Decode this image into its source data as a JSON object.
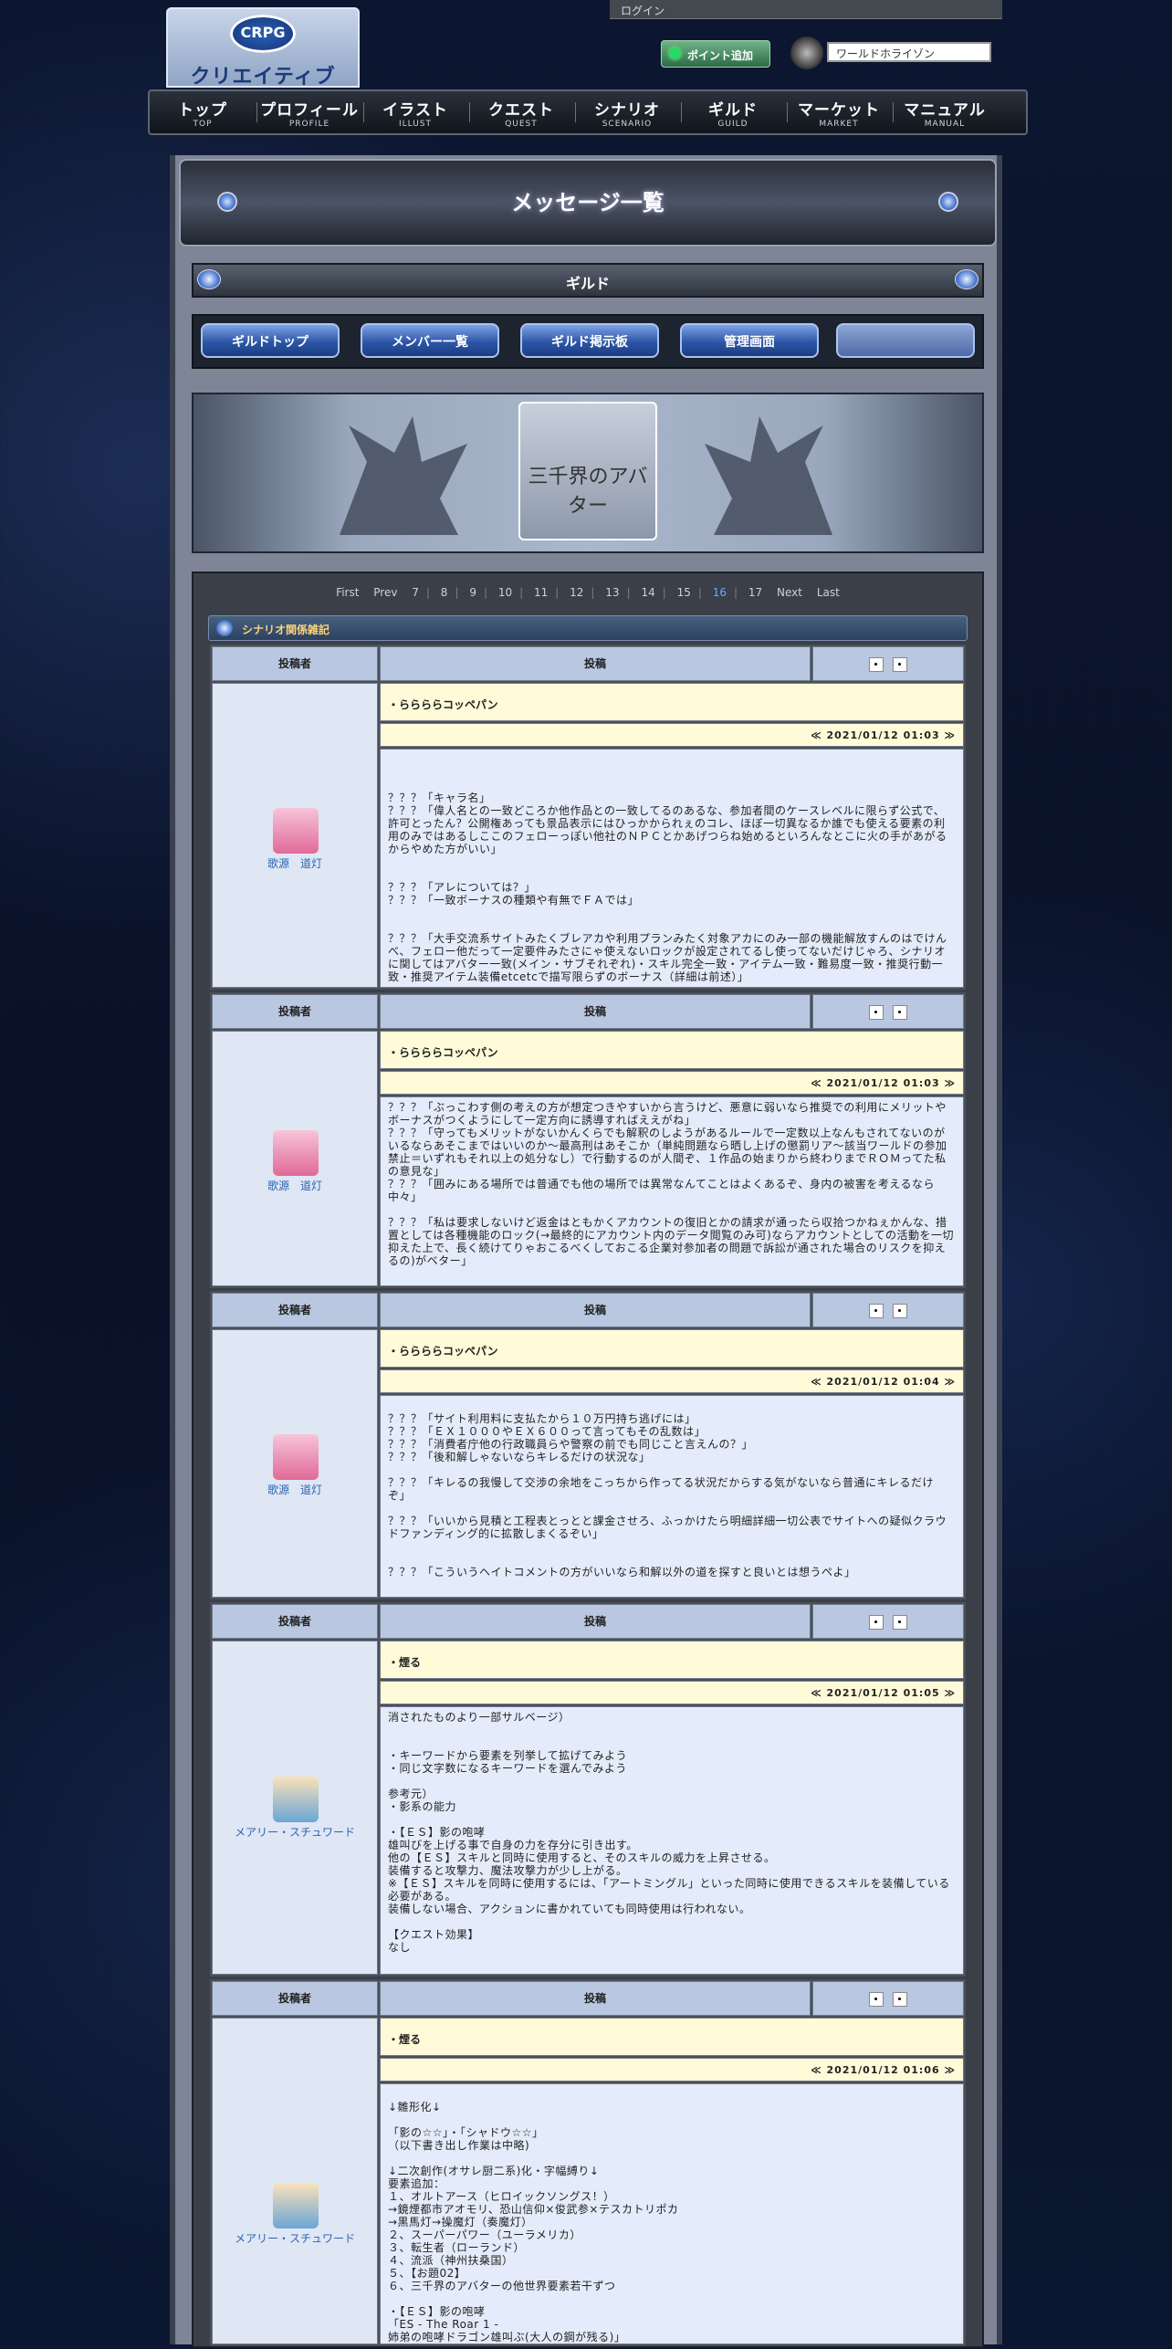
{
  "header": {
    "logo_top": "CRPG",
    "logo_name": "クリエイティブRPG",
    "login": "ログイン",
    "point_button": "ポイント追加",
    "world_value": "ワールドホライゾン"
  },
  "nav": [
    {
      "jp": "トップ",
      "en": "TOP"
    },
    {
      "jp": "プロフィール",
      "en": "PROFILE"
    },
    {
      "jp": "イラスト",
      "en": "ILLUST"
    },
    {
      "jp": "クエスト",
      "en": "QUEST"
    },
    {
      "jp": "シナリオ",
      "en": "SCENARIO"
    },
    {
      "jp": "ギルド",
      "en": "GUILD"
    },
    {
      "jp": "マーケット",
      "en": "MARKET"
    },
    {
      "jp": "マニュアル",
      "en": "MANUAL"
    }
  ],
  "page_title": "メッセージ一覧",
  "guild_bar": "ギルド",
  "guild_tabs": [
    "ギルドトップ",
    "メンバー一覧",
    "ギルド掲示板",
    "管理画面",
    ""
  ],
  "banner_text": "三千界のアバター",
  "pager": {
    "first": "First",
    "prev": "Prev",
    "pages": [
      "7",
      "8",
      "9",
      "10",
      "11",
      "12",
      "13",
      "14",
      "15",
      "16",
      "17"
    ],
    "current": "16",
    "next": "Next",
    "last": "Last"
  },
  "section_title": "シナリオ関係雑記",
  "table_headers": {
    "author": "投稿者",
    "post": "投稿"
  },
  "posts": [
    {
      "author": "歌源　道灯",
      "subject": "・ららららコッペパン",
      "date": "≪ 2021/01/12 01:03 ≫",
      "body": "\n\n\n？？？「キャラ名」\n？？？「偉人名との一致どころか他作品との一致してるのあるな、参加者間のケースレベルに限らず公式で、許可とったん？公開権あっても景品表示にはひっかかられぇのコレ、ほぼ一切異なるか誰でも使える要素の利用のみではあるしここのフェローっぽい他社のＮＰＣとかあげつらね始めるといろんなとこに火の手があがるからやめた方がいい」\n\n\n？？？「アレについては？」\n？？？「一致ボーナスの種類や有無でＦＡでは」\n\n\n？？？「大手交流系サイトみたくブレアカや利用プランみたく対象アカにのみ一部の機能解放すんのはでけんべ、フェロー他だって一定要件みたさにゃ使えないロックが設定されてるし使ってないだけじゃろ、シナリオに関してはアバター一致(メイン・サブそれぞれ)・スキル完全一致・アイテム一致・難易度一致・推奨行動一致・推奨アイテム装備etcetcで描写限らずのボーナス（詳細は前述）」"
    },
    {
      "author": "歌源　道灯",
      "subject": "・ららららコッペパン",
      "date": "≪ 2021/01/12 01:03 ≫",
      "body": "？？？「ぶっこわす側の考えの方が想定つきやすいから言うけど、悪意に弱いなら推奨での利用にメリットやボーナスがつくようにして一定方向に誘導すればええがね」\n？？？「守ってもメリットがないかんくらでも解釈のしようがあるルールで一定数以上なんもされてないのがいるならあそこまではいいのか〜最高刑はあそこか（単純問題なら晒し上げの懲罰リア〜該当ワールドの参加禁止＝いずれもそれ以上の処分なし）で行動するのが人間ぞ、１作品の始まりから終わりまでＲＯＭってた私の意見な」\n？？？「囲みにある場所では普通でも他の場所では異常なんてことはよくあるぞ、身内の被害を考えるなら中々」\n\n？？？「私は要求しないけど返金はともかくアカウントの復旧とかの請求が通ったら収拾つかねぇかんな、措置としては各種機能のロック(→最終的にアカウント内のデータ閲覧のみ可)ならアカウントとしての活動を一切抑えた上で、長く続けてりゃおこるべくしておこる企業対参加者の問題で訴訟が通された場合のリスクを抑えるの)がベター」"
    },
    {
      "author": "歌源　道灯",
      "subject": "・ららららコッペパン",
      "date": "≪ 2021/01/12 01:04 ≫",
      "body": "\n？？？「サイト利用料に支払たから１０万円持ち逃げには」\n？？？「ＥＸ１０００やＥＸ６００って言ってもその乱数は」\n？？？「消費者庁他の行政職員らや警察の前でも同じこと言えんの？」\n？？？「後和解しゃないならキレるだけの状況な」\n\n？？？「キレるの我慢して交渉の余地をこっちから作ってる状況だからする気がないなら普通にキレるだけぞ」\n\n？？？「いいから見積と工程表とっとと課金させろ、ふっかけたら明細詳細一切公表でサイトへの疑似クラウドファンディング的に拡散しまくるぞい」\n\n\n？？？「こういうヘイトコメントの方がいいなら和解以外の道を探すと良いとは想うぺよ」"
    },
    {
      "author": "メアリー・スチュワード",
      "subject": "・煙る",
      "date": "≪ 2021/01/12 01:05 ≫",
      "body": "消されたものより一部サルベージ）\n\n\n・キーワードから要素を列挙して拡げてみよう\n・同じ文字数になるキーワードを選んでみよう\n\n参考元）\n・影系の能力\n\n・【ＥＳ】影の咆哮\n雄叫びを上げる事で自身の力を存分に引き出す。\n他の【ＥＳ】スキルと同時に使用すると、そのスキルの威力を上昇させる。\n装備すると攻撃力、魔法攻撃力が少し上がる。\n※【ＥＳ】スキルを同時に使用するには、「アートミングル」といった同時に使用できるスキルを装備している必要がある。\n装備しない場合、アクションに書かれていても同時使用は行われない。\n\n【クエスト効果】\nなし"
    },
    {
      "author": "メアリー・スチュワード",
      "subject": "・煙る",
      "date": "≪ 2021/01/12 01:06 ≫",
      "body": "\n↓雛形化↓\n\n「影の☆☆」・「シャドウ☆☆」\n（以下書き出し作業は中略)\n\n↓二次創作(オサレ厨二系)化・字幅縛り↓\n要素追加：\n１、オルトアース（ヒロイックソングス！）\n→鏡煙都市アオモリ、恐山信仰×俊武参×テスカトリポカ\n→黒馬灯→操魔灯（奏魔灯）\n２、スーパーパワー（ユーラメリカ）\n３、転生者（ローランド）\n４、流派（神州扶桑国）\n５、【お題02】\n６、三千界のアバターの他世界要素若干ずつ\n\n・【ＥＳ】影の咆哮\n「ES - The Roar 1 -\n姉弟の咆哮ドラゴン雄叫ぶ(大人の鋼が残る)」"
    }
  ],
  "colors": {
    "accent": "#2b66b5",
    "subject_bg": "#fffbd9",
    "body_bg": "#e4ecfb",
    "header_cell": "#b9c8e0"
  }
}
